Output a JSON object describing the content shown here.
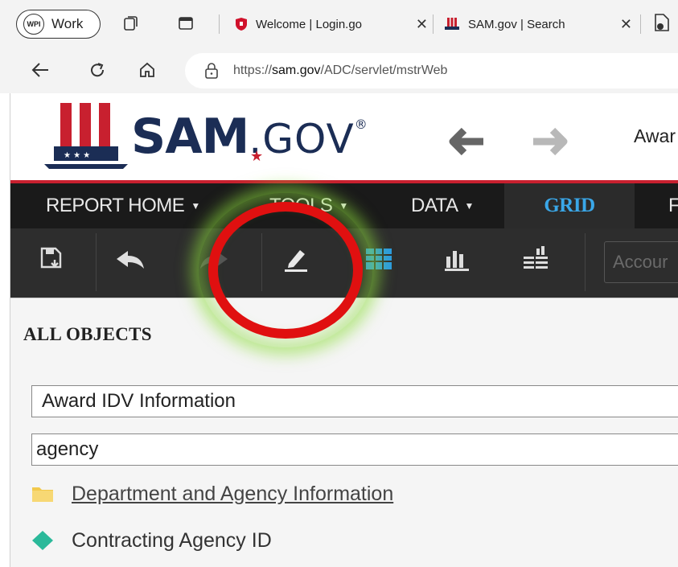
{
  "browser": {
    "profile": {
      "badge": "WPI",
      "name": "Work"
    },
    "tabs": [
      {
        "title": "Welcome | Login.go",
        "close": "✕"
      },
      {
        "title": "SAM.gov | Search",
        "close": "✕"
      }
    ],
    "url": {
      "prefix": "https://",
      "host": "sam.gov",
      "path": "/ADC/servlet/mstrWeb"
    }
  },
  "header": {
    "logo_sam": "SAM",
    "logo_gov": ".GOV",
    "logo_reg": "®",
    "award_text": "Awar"
  },
  "menu": {
    "items": [
      {
        "label": "REPORT HOME",
        "caret": "▼"
      },
      {
        "label": "TOOLS",
        "caret": "▼"
      },
      {
        "label": "DATA",
        "caret": "▼"
      },
      {
        "label": "GRID"
      },
      {
        "label": "F"
      }
    ]
  },
  "toolbar": {
    "search_placeholder": "Accour"
  },
  "object_browser": {
    "title": "ALL OBJECTS",
    "selected_folder": "Award IDV Information",
    "search_value": "agency",
    "results": [
      {
        "label": "Department and Agency Information",
        "icon": "folder-icon"
      },
      {
        "label": "Contracting Agency ID",
        "icon": "attribute-diamond-icon"
      }
    ]
  },
  "colors": {
    "brand_navy": "#1b2d55",
    "brand_red": "#c8202f",
    "grid_active": "#3aa7e8",
    "annotation_red": "#e01010",
    "annotation_glow": "#8cdc3c"
  }
}
